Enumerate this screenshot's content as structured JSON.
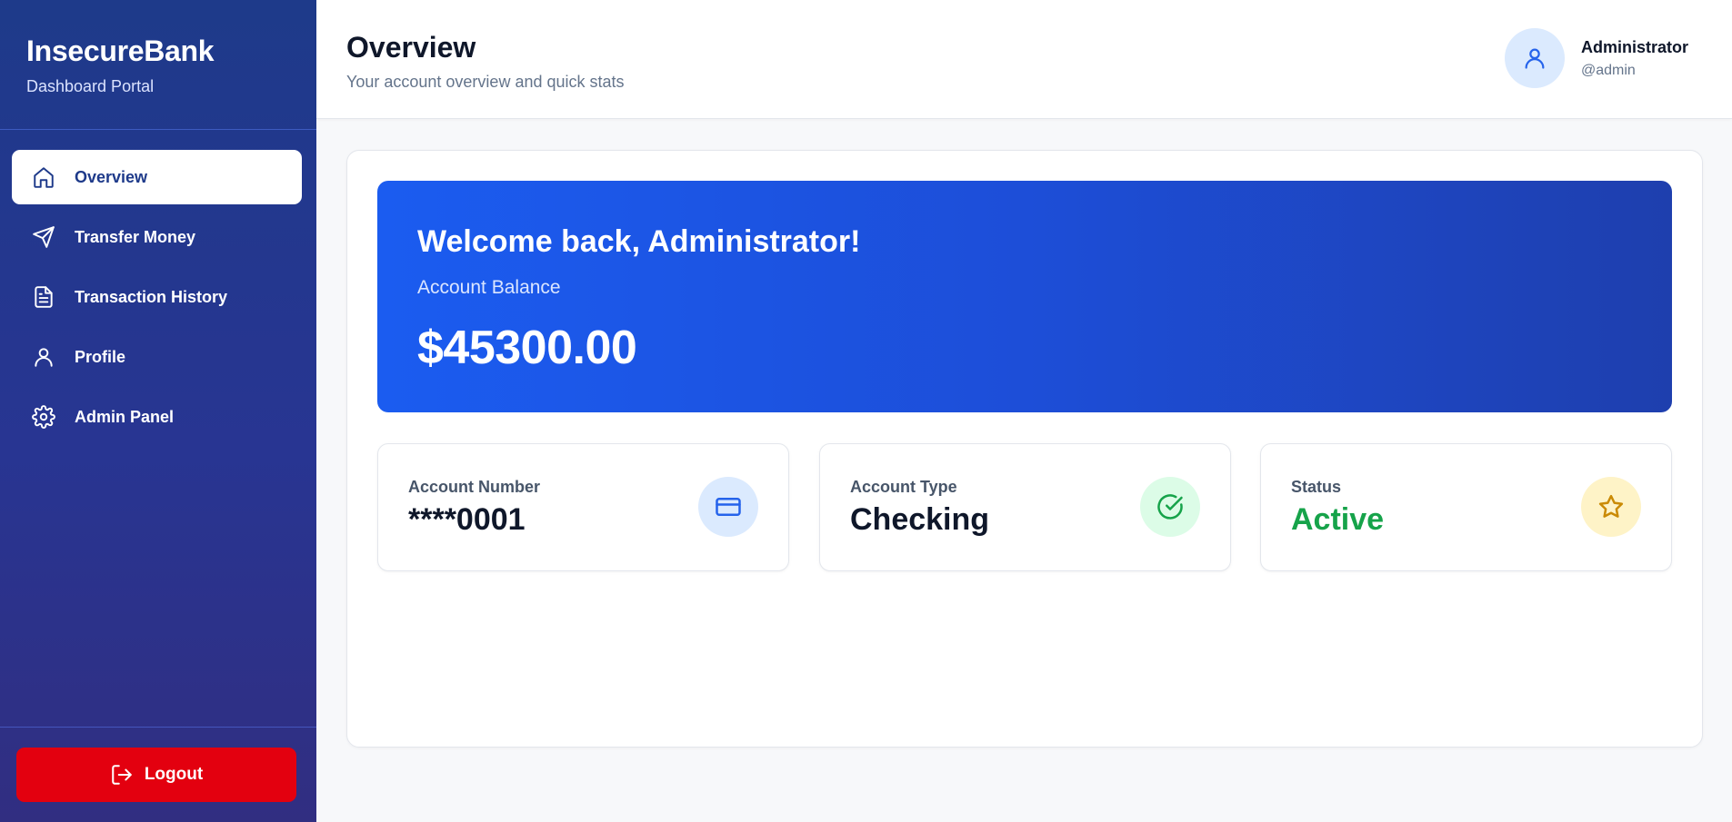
{
  "brand": {
    "title": "InsecureBank",
    "subtitle": "Dashboard Portal"
  },
  "nav": [
    {
      "label": "Overview",
      "icon": "home-icon",
      "active": true
    },
    {
      "label": "Transfer Money",
      "icon": "send-icon",
      "active": false
    },
    {
      "label": "Transaction History",
      "icon": "document-icon",
      "active": false
    },
    {
      "label": "Profile",
      "icon": "user-icon",
      "active": false
    },
    {
      "label": "Admin Panel",
      "icon": "gear-icon",
      "active": false
    }
  ],
  "logout": {
    "label": "Logout",
    "icon": "logout-icon"
  },
  "header": {
    "title": "Overview",
    "subtitle": "Your account overview and quick stats",
    "user_name": "Administrator",
    "user_handle": "@admin"
  },
  "welcome": {
    "title": "Welcome back, Administrator!",
    "balance_label": "Account Balance",
    "balance_value": "$45300.00"
  },
  "stats": [
    {
      "label": "Account Number",
      "value": "****0001",
      "icon": "credit-card-icon"
    },
    {
      "label": "Account Type",
      "value": "Checking",
      "icon": "check-circle-icon"
    },
    {
      "label": "Status",
      "value": "Active",
      "icon": "star-icon"
    }
  ],
  "colors": {
    "sidebar_top": "#1e3a8a",
    "sidebar_bottom": "#312e81",
    "logout": "#e3000f",
    "banner_start": "#1b5cf0",
    "banner_end": "#1e3fae",
    "status_active": "#16a34a"
  }
}
